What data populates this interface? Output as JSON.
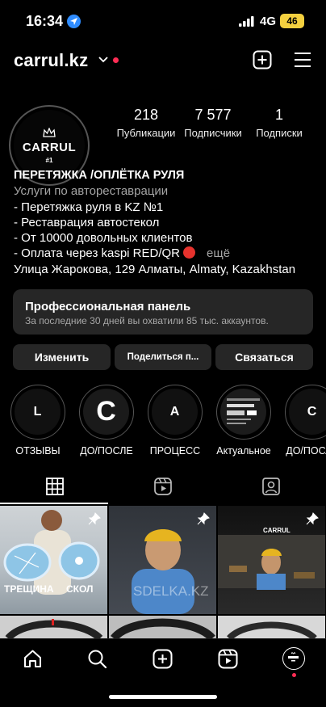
{
  "status": {
    "time": "16:34",
    "network": "4G",
    "battery": "46"
  },
  "header": {
    "username": "carrul.kz"
  },
  "avatar": {
    "logo_text": "CARRUL",
    "logo_sub": "#1"
  },
  "stats": [
    {
      "value": "218",
      "label": "Публикации"
    },
    {
      "value": "7 577",
      "label": "Подписчики"
    },
    {
      "value": "1",
      "label": "Подписки"
    }
  ],
  "bio": {
    "name": "ПЕРЕТЯЖКА /ОПЛЁТКА РУЛЯ",
    "category": "Услуги по автореставрации",
    "lines": [
      "- Перетяжка руля в KZ №1",
      "- Реставрация автостекол",
      "- От 10000 довольных клиентов",
      "- Оплата через kaspi RED/QR"
    ],
    "more": "ещё",
    "address": "Улица Жарокова, 129 Алматы, Almaty, Kazakhstan"
  },
  "pro_panel": {
    "title": "Профессиональная панель",
    "subtitle": "За последние 30 дней вы охватили 85 тыс. аккаунтов."
  },
  "buttons": {
    "edit": "Изменить",
    "share": "Поделиться п...",
    "contact": "Связаться"
  },
  "highlights": [
    {
      "label": "ОТЗЫВЫ",
      "icon_text": "L"
    },
    {
      "label": "ДО/ПОСЛЕ",
      "icon_text": "C"
    },
    {
      "label": "ПРОЦЕСС",
      "icon_text": "A"
    },
    {
      "label": "Актуальное",
      "icon_text": ""
    },
    {
      "label": "ДО/ПОСЛЕ",
      "icon_text": "C"
    }
  ],
  "grid": {
    "post1_caption_left": "ТРЕЩИНА",
    "post1_caption_right": "СКОЛ",
    "post2_watermark": "SDELKA.KZ",
    "post3_sign": "CARRUL"
  },
  "colors": {
    "accent_blue": "#2f8cff",
    "notification_red": "#ff2d55",
    "battery_yellow": "#f4d03f",
    "panel_bg": "#262626"
  }
}
